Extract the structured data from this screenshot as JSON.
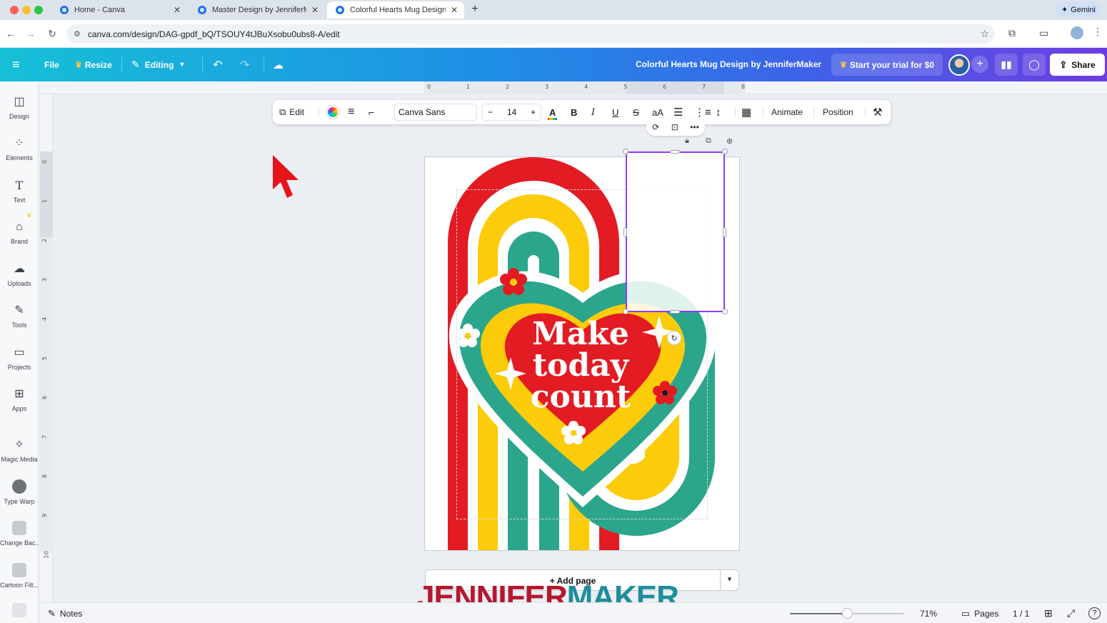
{
  "browser": {
    "tabs": [
      {
        "title": "Home - Canva"
      },
      {
        "title": "Master Design by JenniferMaker"
      },
      {
        "title": "Colorful Hearts Mug Design by JenniferMaker",
        "active": true
      }
    ],
    "url": "canva.com/design/DAG-gpdf_bQ/TSOUY4tJBuXsobu0ubs8-A/edit",
    "gemini_label": "Gemini"
  },
  "header": {
    "file_label": "File",
    "resize_label": "Resize",
    "editing_label": "Editing",
    "doc_title": "Colorful Hearts Mug Design by JenniferMaker",
    "trial_label": "Start your trial for $0",
    "share_label": "Share"
  },
  "sidebar": {
    "items": [
      {
        "label": "Design",
        "icon": "design-icon"
      },
      {
        "label": "Elements",
        "icon": "elements-icon"
      },
      {
        "label": "Text",
        "icon": "text-icon"
      },
      {
        "label": "Brand",
        "icon": "brand-icon"
      },
      {
        "label": "Uploads",
        "icon": "uploads-icon"
      },
      {
        "label": "Tools",
        "icon": "tools-icon"
      },
      {
        "label": "Projects",
        "icon": "projects-icon"
      },
      {
        "label": "Apps",
        "icon": "apps-icon"
      },
      {
        "label": "Magic Media",
        "icon": "magic-media-icon"
      },
      {
        "label": "Type Warp",
        "icon": "type-warp-icon"
      },
      {
        "label": "Change Bac...",
        "icon": "change-background-icon"
      },
      {
        "label": "Cartoon Filt...",
        "icon": "cartoon-filter-icon"
      }
    ]
  },
  "rulers": {
    "top": [
      "0",
      "1",
      "2",
      "3",
      "4",
      "5",
      "6",
      "7",
      "8"
    ],
    "left": [
      "0",
      "1",
      "2",
      "3",
      "4",
      "5",
      "6",
      "7",
      "8",
      "9",
      "10"
    ]
  },
  "toolbar": {
    "edit_label": "Edit",
    "font_name": "Canva Sans",
    "font_size": "14",
    "decrease_label": "−",
    "increase_label": "+",
    "bold_label": "B",
    "italic_label": "I",
    "underline_label": "U",
    "strike_label": "S",
    "case_label": "aA",
    "text_color_label": "A",
    "animate_label": "Animate",
    "position_label": "Position"
  },
  "canvas": {
    "headline_lines": [
      "Make",
      "today",
      "count"
    ],
    "add_page_label": "+ Add page"
  },
  "watermark": {
    "part1": "JENNIFER",
    "part2": "MAKER"
  },
  "bottom": {
    "notes_label": "Notes",
    "zoom_label": "71%",
    "zoom_fraction": 0.71,
    "pages_label": "Pages",
    "page_count": "1 / 1"
  },
  "colors": {
    "red": "#e31b23",
    "yellow": "#fccb0a",
    "teal": "#2ba68c",
    "selection": "#8b3dff"
  }
}
